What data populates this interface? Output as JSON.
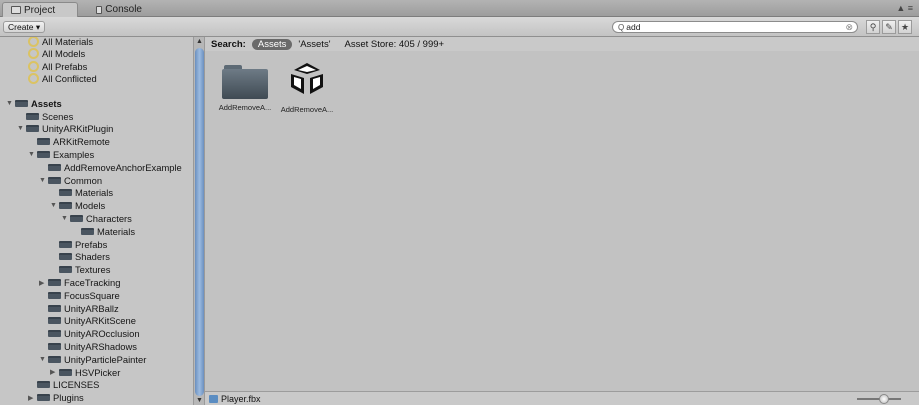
{
  "tabs": [
    {
      "label": "Project",
      "icon": "project-icon"
    },
    {
      "label": "Console",
      "icon": "console-icon"
    }
  ],
  "window_controls": "▲ ≡",
  "toolbar": {
    "create_label": "Create ▾",
    "search_value": "add",
    "search_icon": "Q",
    "clear_icon": "⊗",
    "buttons": [
      "⚲",
      "✎",
      "★"
    ]
  },
  "favorites": [
    "All Materials",
    "All Models",
    "All Prefabs",
    "All Conflicted"
  ],
  "tree": [
    {
      "label": "Assets",
      "indent": 0,
      "expand": "open",
      "bold": true
    },
    {
      "label": "Scenes",
      "indent": 1,
      "expand": "none"
    },
    {
      "label": "UnityARKitPlugin",
      "indent": 1,
      "expand": "open"
    },
    {
      "label": "ARKitRemote",
      "indent": 2,
      "expand": "none"
    },
    {
      "label": "Examples",
      "indent": 2,
      "expand": "open"
    },
    {
      "label": "AddRemoveAnchorExample",
      "indent": 3,
      "expand": "none"
    },
    {
      "label": "Common",
      "indent": 3,
      "expand": "open"
    },
    {
      "label": "Materials",
      "indent": 4,
      "expand": "none"
    },
    {
      "label": "Models",
      "indent": 4,
      "expand": "open"
    },
    {
      "label": "Characters",
      "indent": 5,
      "expand": "open"
    },
    {
      "label": "Materials",
      "indent": 6,
      "expand": "none"
    },
    {
      "label": "Prefabs",
      "indent": 4,
      "expand": "none"
    },
    {
      "label": "Shaders",
      "indent": 4,
      "expand": "none"
    },
    {
      "label": "Textures",
      "indent": 4,
      "expand": "none"
    },
    {
      "label": "FaceTracking",
      "indent": 3,
      "expand": "closed"
    },
    {
      "label": "FocusSquare",
      "indent": 3,
      "expand": "none"
    },
    {
      "label": "UnityARBallz",
      "indent": 3,
      "expand": "none"
    },
    {
      "label": "UnityARKitScene",
      "indent": 3,
      "expand": "none"
    },
    {
      "label": "UnityAROcclusion",
      "indent": 3,
      "expand": "none"
    },
    {
      "label": "UnityARShadows",
      "indent": 3,
      "expand": "none"
    },
    {
      "label": "UnityParticlePainter",
      "indent": 3,
      "expand": "open"
    },
    {
      "label": "HSVPicker",
      "indent": 4,
      "expand": "closed"
    },
    {
      "label": "LICENSES",
      "indent": 2,
      "expand": "none"
    },
    {
      "label": "Plugins",
      "indent": 2,
      "expand": "closed"
    }
  ],
  "filter": {
    "search_label": "Search:",
    "assets_pill": "Assets",
    "assets_quoted": "'Assets'",
    "asset_store": "Asset Store: 405 / 999+"
  },
  "assets": [
    {
      "label": "AddRemoveA...",
      "icon": "folder-icon"
    },
    {
      "label": "AddRemoveA...",
      "icon": "unity-scene-icon"
    }
  ],
  "status": {
    "selected_file": "Player.fbx"
  }
}
